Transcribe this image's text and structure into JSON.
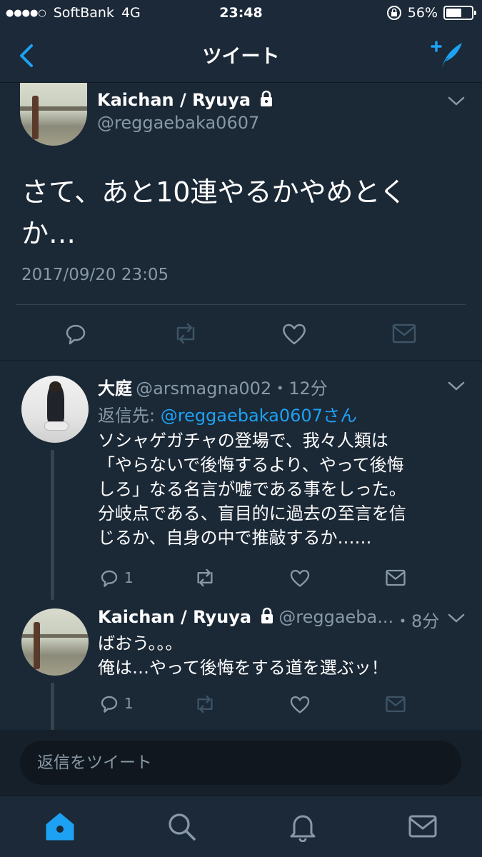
{
  "status": {
    "carrier": "SoftBank",
    "network": "4G",
    "time": "23:48",
    "battery": "56%",
    "battery_level": 0.56
  },
  "nav": {
    "title": "ツイート",
    "back_icon": "chevron-left-icon",
    "compose_icon": "compose-tweet-icon"
  },
  "main_tweet": {
    "name": "Kaichan / Ryuya",
    "handle": "@reggaebaka0607",
    "text_line1": "さて、あと10連やるかやめとく",
    "text_line2": "か…",
    "date": "2017/09/20 23:05"
  },
  "reply1": {
    "name": "大庭",
    "handle": "@arsmagna002",
    "time": "・12分",
    "reply_to_label": "返信先: ",
    "reply_to_handle": "@reggaebaka0607さん",
    "lines": [
      "ソシャゲガチャの登場で、我々人類は",
      "「やらないで後悔するより、やって後悔",
      "しろ」なる名言が嘘である事をしった。",
      "分岐点である、盲目的に過去の至言を信",
      "じるか、自身の中で推敲するか……"
    ],
    "reply_count": "1"
  },
  "reply2": {
    "name": "Kaichan / Ryuya",
    "handle": "@reggaeba...",
    "time": "・8分",
    "lines": [
      "ばおう。。。",
      "俺は…やって後悔をする道を選ぶッ！"
    ],
    "reply_count": "1"
  },
  "composer": {
    "placeholder": "返信をツイート"
  },
  "tabs": [
    "home-icon",
    "search-icon",
    "notifications-icon",
    "messages-icon"
  ],
  "colors": {
    "accent": "#1da1f2",
    "background": "#15202b",
    "muted": "#8899a6"
  }
}
